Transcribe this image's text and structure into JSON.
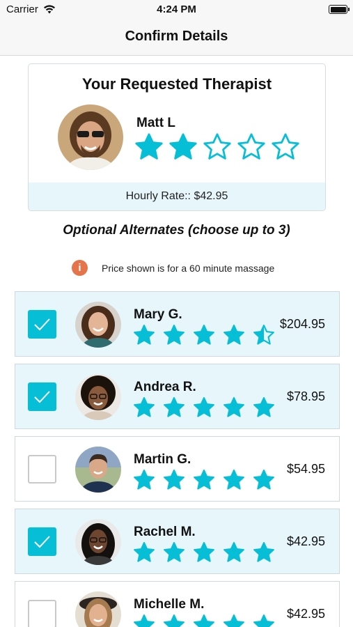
{
  "status_bar": {
    "carrier": "Carrier",
    "time": "4:24 PM"
  },
  "nav": {
    "title": "Confirm Details"
  },
  "requested": {
    "title": "Your Requested Therapist",
    "name": "Matt L",
    "rating": 2,
    "max_rating": 5,
    "rate_text": "Hourly Rate:: $42.95"
  },
  "alternates_heading": "Optional Alternates (choose up to 3)",
  "notice": {
    "icon": "info-icon",
    "text": "Price shown is for a 60 minute massage"
  },
  "alternates": [
    {
      "name": "Mary G.",
      "price": "$204.95",
      "rating": 4.5,
      "checked": true
    },
    {
      "name": "Andrea R.",
      "price": "$78.95",
      "rating": 5,
      "checked": true
    },
    {
      "name": "Martin G.",
      "price": "$54.95",
      "rating": 5,
      "checked": false
    },
    {
      "name": "Rachel M.",
      "price": "$42.95",
      "rating": 5,
      "checked": true
    },
    {
      "name": "Michelle M.",
      "price": "$42.95",
      "rating": 5,
      "checked": false
    }
  ],
  "colors": {
    "accent": "#06bfd6",
    "selected_row": "#e6f6fb",
    "info": "#e5744a"
  }
}
